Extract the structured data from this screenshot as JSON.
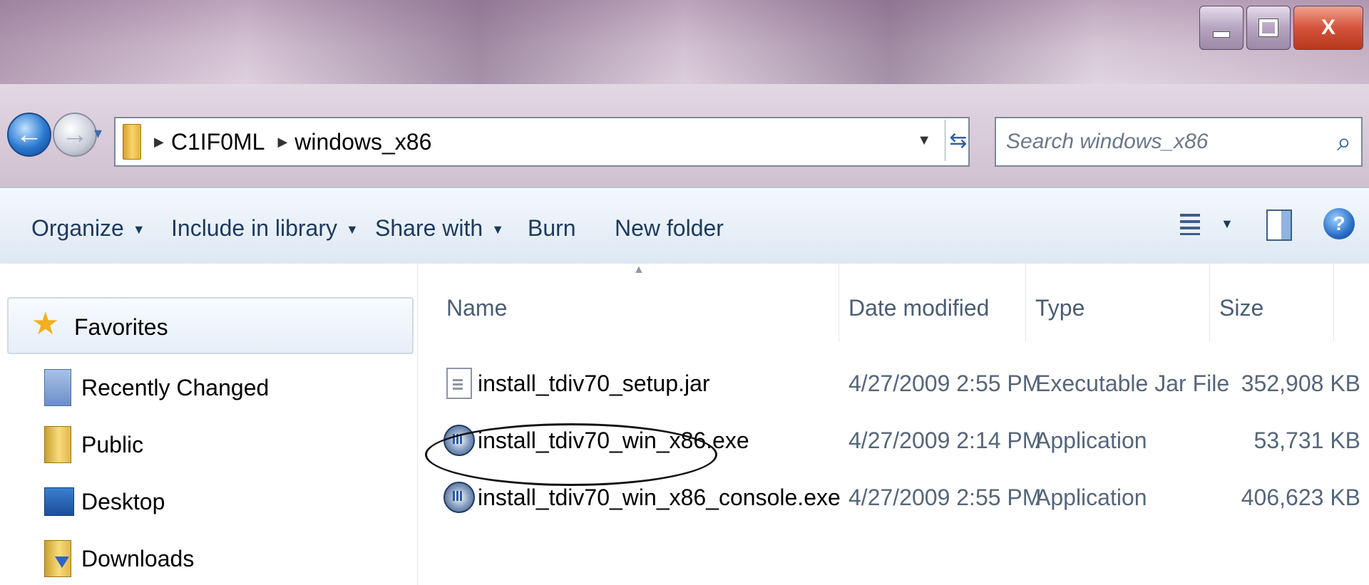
{
  "titlebar": {
    "close_label": "X"
  },
  "address": {
    "crumbs": [
      "C1IF0ML",
      "windows_x86"
    ]
  },
  "search": {
    "placeholder": "Search windows_x86"
  },
  "toolbar": {
    "organize": "Organize",
    "include_in_library": "Include in library",
    "share_with": "Share with",
    "burn": "Burn",
    "new_folder": "New folder"
  },
  "navpane": {
    "favorites_label": "Favorites",
    "items": [
      {
        "label": "Recently Changed",
        "icon": "recently-changed-icon"
      },
      {
        "label": "Public",
        "icon": "folder-icon"
      },
      {
        "label": "Desktop",
        "icon": "desktop-icon"
      },
      {
        "label": "Downloads",
        "icon": "downloads-icon"
      }
    ]
  },
  "files": {
    "columns": [
      "Name",
      "Date modified",
      "Type",
      "Size"
    ],
    "rows": [
      {
        "name": "install_tdiv70_setup.jar",
        "date": "4/27/2009 2:55 PM",
        "type": "Executable Jar File",
        "size": "352,908 KB",
        "icon": "jar-file-icon"
      },
      {
        "name": "install_tdiv70_win_x86.exe",
        "date": "4/27/2009 2:14 PM",
        "type": "Application",
        "size": "53,731 KB",
        "icon": "exe-file-icon",
        "circled": true
      },
      {
        "name": "install_tdiv70_win_x86_console.exe",
        "date": "4/27/2009 2:55 PM",
        "type": "Application",
        "size": "406,623 KB",
        "icon": "exe-file-icon"
      }
    ]
  }
}
